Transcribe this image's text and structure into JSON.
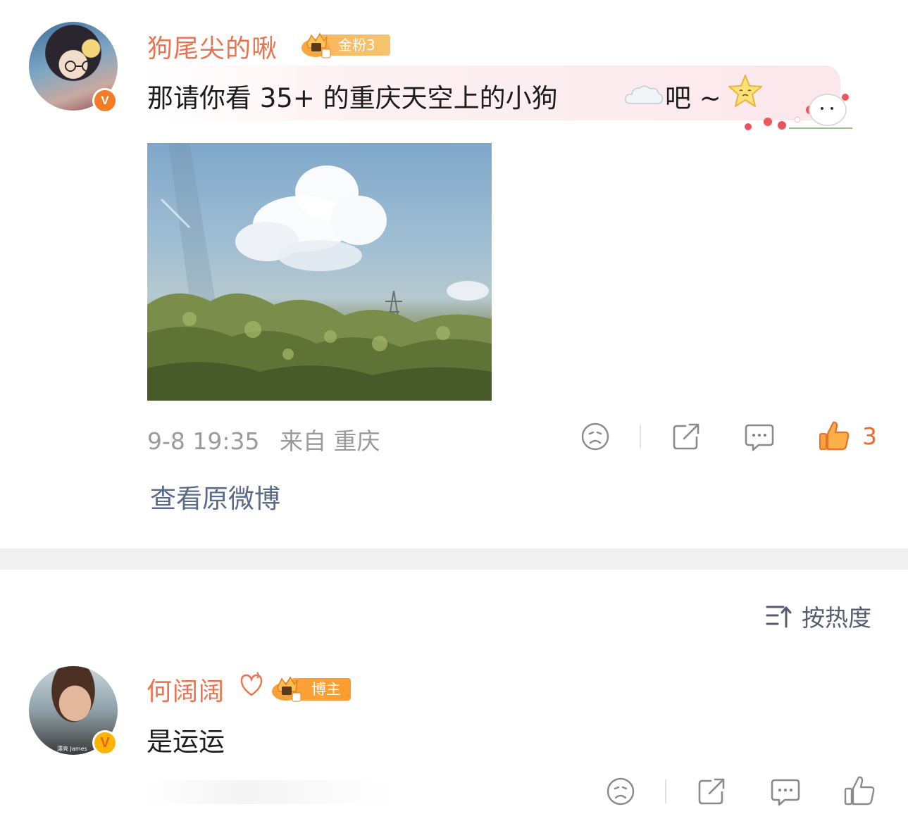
{
  "comment1": {
    "username": "狗尾尖的啾",
    "fan_badge": "金粉3",
    "text_main": "那请你看 35+ 的重庆天空上的小狗",
    "text_tail": "吧 ~",
    "emojis": [
      "cloud-emoji",
      "star-face-emoji"
    ],
    "date": "9-8 19:35",
    "source": "来自 重庆",
    "like_count": "3"
  },
  "view_original": "查看原微博",
  "sort": {
    "label": "按热度"
  },
  "comment2": {
    "username": "何阔阔",
    "role_badge": "博主",
    "text": "是运运",
    "avatar_caption": "漂亮 James"
  },
  "colors": {
    "username": "#eb7350",
    "like_active": "#e86b2c",
    "link": "#5a6a8a",
    "meta": "#9a9a9a",
    "separator": "#f0f0f0"
  },
  "icons": [
    "dislike-icon",
    "share-icon",
    "comment-icon",
    "like-icon",
    "sort-icon",
    "verified-icon",
    "crown-icon"
  ]
}
